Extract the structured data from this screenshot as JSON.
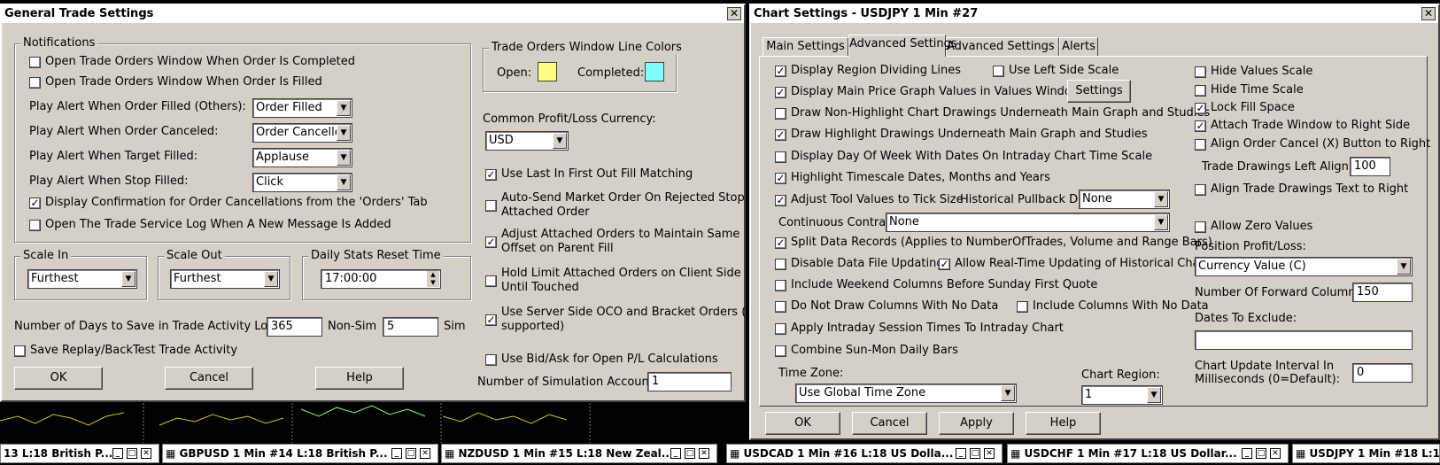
{
  "trade_settings": {
    "title": "General Trade Settings",
    "close": "✕",
    "notifications": {
      "legend": "Notifications",
      "open_on_completed": "Open Trade Orders Window When Order Is Completed",
      "open_on_filled": "Open Trade Orders Window When Order Is Filled",
      "alert_filled_label": "Play Alert When Order Filled (Others):",
      "alert_filled_value": "Order Filled",
      "alert_canceled_label": "Play Alert When Order Canceled:",
      "alert_canceled_value": "Order Cancelled",
      "alert_target_label": "Play Alert When Target Filled:",
      "alert_target_value": "Applause",
      "alert_stop_label": "Play Alert When Stop Filled:",
      "alert_stop_value": "Click",
      "confirm_cancel": "Display Confirmation for Order Cancellations from the 'Orders' Tab",
      "open_log": "Open The Trade Service Log When A New Message Is Added"
    },
    "scale_in": {
      "legend": "Scale In",
      "value": "Furthest"
    },
    "scale_out": {
      "legend": "Scale Out",
      "value": "Furthest"
    },
    "daily_reset": {
      "legend": "Daily Stats Reset Time",
      "value": "17:00:00"
    },
    "days_label": "Number of Days to Save in Trade Activity Log:",
    "days_value": "365",
    "nonsim_label": "Non-Sim",
    "sim_value": "5",
    "sim_label": "Sim",
    "save_replay": "Save Replay/BackTest Trade Activity",
    "ok": "OK",
    "cancel": "Cancel",
    "help": "Help",
    "colors": {
      "legend": "Trade Orders Window Line Colors",
      "open_label": "Open:",
      "completed_label": "Completed:",
      "open_color": "#ffff80",
      "completed_color": "#80ffff"
    },
    "currency_label": "Common Profit/Loss Currency:",
    "currency_value": "USD",
    "lifo": "Use Last In First Out Fill Matching",
    "auto_send": "Auto-Send Market Order On Rejected Stop",
    "auto_send_2": "Attached Order",
    "adjust_attached": "Adjust Attached Orders to Maintain Same",
    "adjust_attached_2": "Offset on Parent Fill",
    "hold_limit": "Hold Limit Attached Orders on Client Side",
    "hold_limit_2": "Until Touched",
    "server_oco": "Use Server Side OCO and Bracket Orders (if",
    "server_oco_2": "supported)",
    "bid_ask": "Use Bid/Ask for Open P/L Calculations",
    "sim_accounts_label": "Number of Simulation Accounts:",
    "sim_accounts_value": "1"
  },
  "chart_settings": {
    "title": "Chart Settings - USDJPY  1 Min   #27",
    "close": "✕",
    "tabs": [
      "Main Settings",
      "Advanced Settings",
      "Advanced Settings 2",
      "Alerts"
    ],
    "display_region_lines": "Display Region Dividing Lines",
    "use_left_scale": "Use Left Side Scale",
    "display_main_values": "Display Main Price Graph Values in Values Windows",
    "settings_button": "Settings",
    "draw_nonhighlight": "Draw Non-Highlight Chart Drawings Underneath Main Graph and Studies",
    "draw_highlight": "Draw Highlight Drawings Underneath Main Graph and Studies",
    "display_dow": "Display Day Of Week With Dates On Intraday Chart Time Scale",
    "highlight_timescale": "Highlight Timescale Dates, Months and Years",
    "adjust_tool": "Adjust Tool Values to Tick Size",
    "pullback_label": "Historical Pullback Data:",
    "pullback_value": "None",
    "continuous_label": "Continuous Contract:",
    "continuous_value": "None",
    "split_records": "Split Data Records (Applies to NumberOfTrades, Volume and Range Bars)",
    "disable_updating": "Disable Data File Updating",
    "allow_realtime": "Allow Real-Time Updating of Historical Chart",
    "include_weekend": "Include Weekend Columns Before Sunday First Quote",
    "no_draw_columns": "Do Not Draw Columns With No Data",
    "include_columns": "Include Columns With No Data",
    "apply_session": "Apply Intraday Session Times To Intraday Chart",
    "combine_sunmon": "Combine Sun-Mon Daily Bars",
    "timezone_label": "Time Zone:",
    "timezone_value": "Use Global Time Zone",
    "region_label": "Chart Region:",
    "region_value": "1",
    "hide_values": "Hide Values Scale",
    "hide_time": "Hide Time Scale",
    "lock_fill": "Lock Fill Space",
    "attach_trade": "Attach Trade Window to Right Side",
    "align_cancel": "Align Order Cancel (X) Button to Right",
    "drawings_left_label": "Trade Drawings Left Align",
    "drawings_left_value": "100",
    "align_text": "Align Trade Drawings Text to Right",
    "allow_zero": "Allow Zero Values",
    "position_pl_label": "Position Profit/Loss:",
    "position_pl_value": "Currency Value (C)",
    "forward_label": "Number Of Forward Columns:",
    "forward_value": "150",
    "dates_label": "Dates To Exclude:",
    "dates_value": "",
    "interval_label": "Chart Update Interval In",
    "interval_label_2": "Milliseconds (0=Default):",
    "interval_value": "0",
    "ok": "OK",
    "cancel": "Cancel",
    "apply": "Apply",
    "help": "Help"
  },
  "taskbar": [
    "13  L:18  British P...",
    "GBPUSD  1 Min  #14  L:18  British P...",
    "NZDUSD  1 Min  #15  L:18  New Zeal...",
    "USDCAD  1 Min  #16  L:18  US Dolla...",
    "USDCHF  1 Min  #17  L:18  US Dollar...",
    "USDJPY  1 Min  #18  L:1"
  ],
  "check": "✓"
}
